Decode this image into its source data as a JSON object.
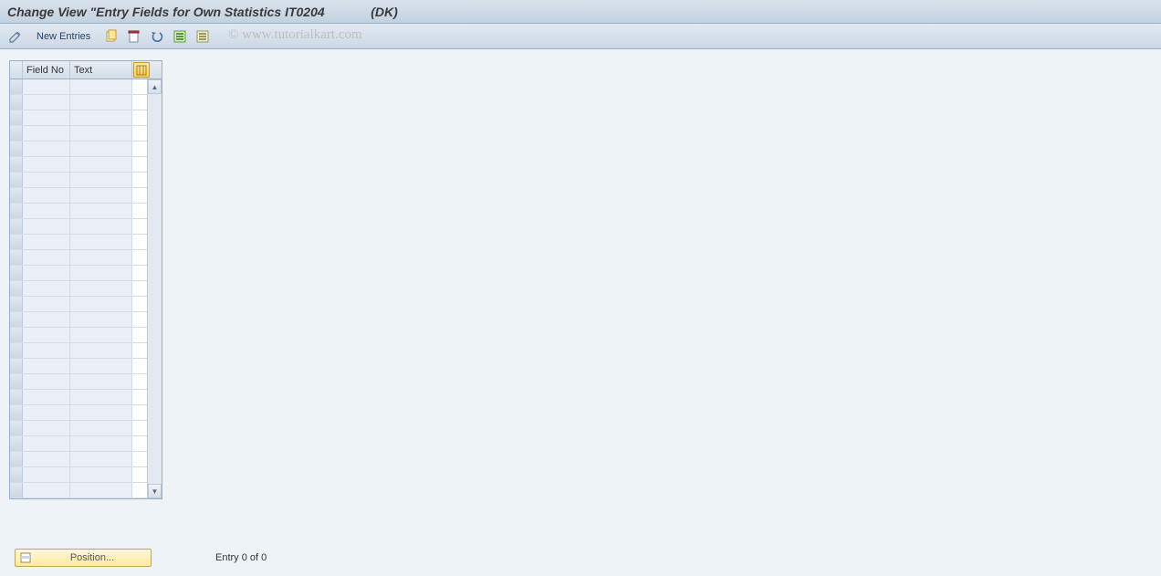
{
  "title": "Change View \"Entry Fields for Own Statistics IT0204             (DK)",
  "toolbar": {
    "new_entries": "New Entries"
  },
  "watermark": "© www.tutorialkart.com",
  "table": {
    "columns": {
      "field_no": "Field No",
      "text": "Text"
    },
    "row_count": 27
  },
  "footer": {
    "position_label": "Position...",
    "entry_text": "Entry 0 of 0"
  }
}
